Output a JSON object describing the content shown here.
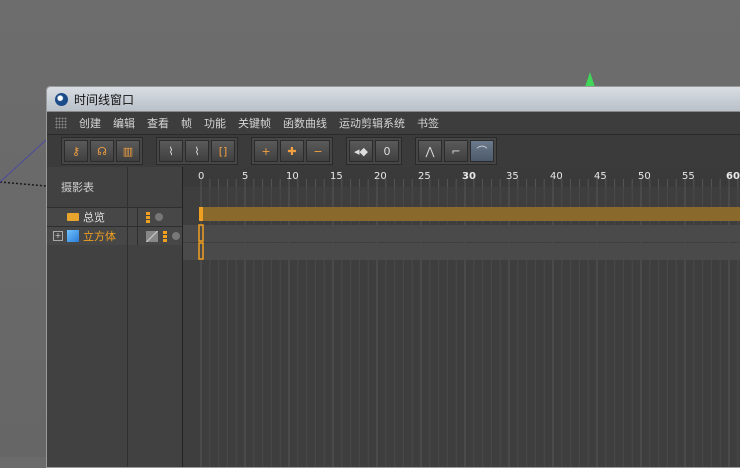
{
  "window": {
    "title": "时间线窗口"
  },
  "menu": [
    "创建",
    "编辑",
    "查看",
    "帧",
    "功能",
    "关键帧",
    "函数曲线",
    "运动剪辑系统",
    "书签"
  ],
  "toolbar": {
    "groups": [
      [
        "key-icon",
        "motion-icon",
        "film-icon"
      ],
      [
        "curve-snap-icon",
        "curve-snap-2-icon",
        "bracket-icon"
      ],
      [
        "add-key-icon",
        "add-keys-icon",
        "remove-key-icon"
      ],
      [
        "key-zero-icon",
        "value-zero-icon"
      ],
      [
        "peak-icon",
        "step-icon",
        "smooth-icon"
      ],
      [
        "ease-in-icon",
        "ease-out-icon",
        "ease-both-icon"
      ],
      [
        "tangent-1-icon",
        "tangent-2-icon",
        "tangent-3-icon",
        "tangent-4-icon"
      ]
    ]
  },
  "left_panel": {
    "header": "摄影表",
    "tracks": [
      {
        "name": "总览",
        "icon": "folder-icon"
      },
      {
        "name": "立方体",
        "icon": "cube-icon"
      }
    ]
  },
  "ruler": {
    "labels": [
      "0",
      "5",
      "10",
      "15",
      "20",
      "25",
      "30",
      "35",
      "40",
      "45",
      "50",
      "55",
      "60"
    ]
  },
  "colors": {
    "accent": "#f0a020",
    "track_bar": "#8a6a2c"
  }
}
